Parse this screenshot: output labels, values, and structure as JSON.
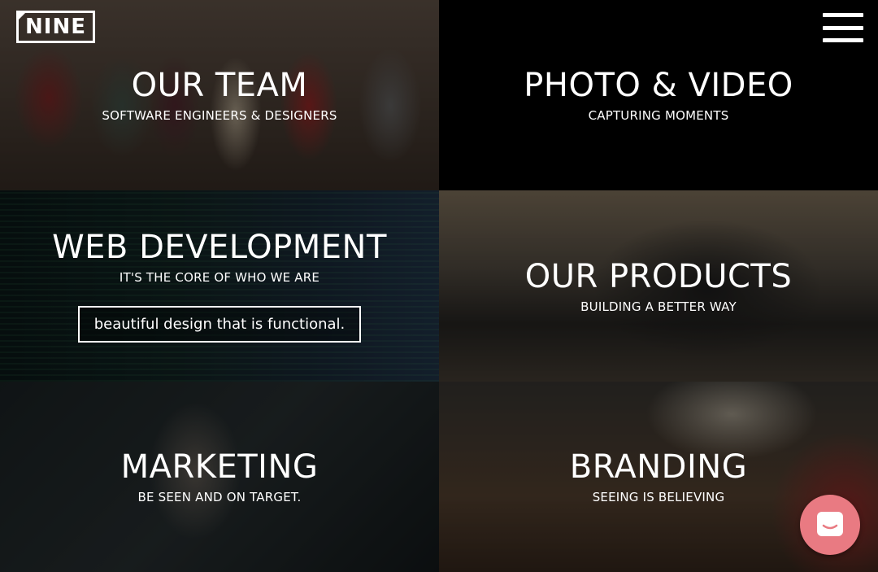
{
  "logo": {
    "text": "NINE"
  },
  "menu": {
    "icon": "hamburger-menu-icon"
  },
  "chat": {
    "icon": "chat-bubble-icon",
    "color": "#e97a82"
  },
  "tiles": [
    {
      "title": "OUR TEAM",
      "subtitle": "SOFTWARE ENGINEERS & DESIGNERS"
    },
    {
      "title": "PHOTO & VIDEO",
      "subtitle": "CAPTURING MOMENTS"
    },
    {
      "title": "WEB DEVELOPMENT",
      "subtitle": "IT'S THE CORE OF WHO WE ARE",
      "cta": "beautiful design that is functional."
    },
    {
      "title": "OUR PRODUCTS",
      "subtitle": "BUILDING A BETTER WAY"
    },
    {
      "title": "MARKETING",
      "subtitle": "BE SEEN AND ON TARGET."
    },
    {
      "title": "BRANDING",
      "subtitle": "SEEING IS BELIEVING"
    }
  ]
}
